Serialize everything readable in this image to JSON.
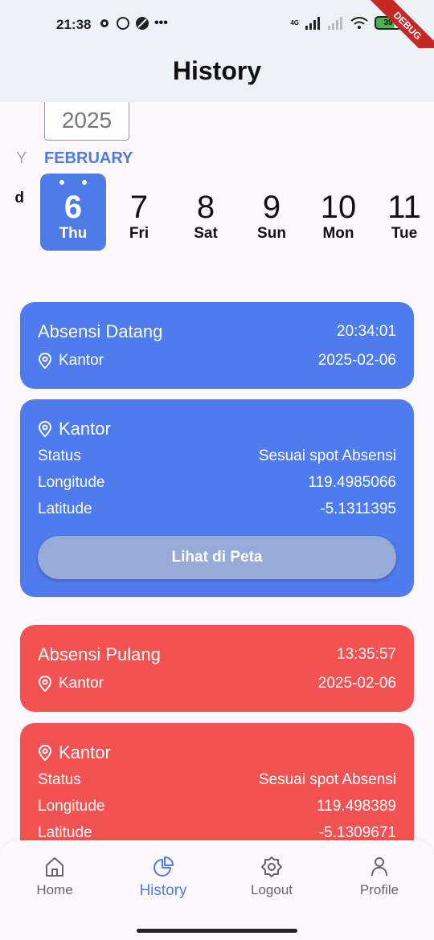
{
  "status_bar": {
    "time": "21:38",
    "battery": "39",
    "debug_label": "DEBUG",
    "network": "4G"
  },
  "app_bar": {
    "title": "History"
  },
  "calendar": {
    "year": "2025",
    "prev_month_fragment": "Y",
    "month": "FEBRUARY",
    "days": [
      {
        "num": "",
        "day": "d"
      },
      {
        "num": "6",
        "day": "Thu",
        "selected": true
      },
      {
        "num": "7",
        "day": "Fri"
      },
      {
        "num": "8",
        "day": "Sat"
      },
      {
        "num": "9",
        "day": "Sun"
      },
      {
        "num": "10",
        "day": "Mon"
      },
      {
        "num": "11",
        "day": "Tue"
      }
    ]
  },
  "records": [
    {
      "summary": {
        "title": "Absensi Datang",
        "time": "20:34:01",
        "location": "Kantor",
        "date": "2025-02-06"
      },
      "detail": {
        "location": "Kantor",
        "status_label": "Status",
        "status": "Sesuai spot Absensi",
        "longitude_label": "Longitude",
        "longitude": "119.4985066",
        "latitude_label": "Latitude",
        "latitude": "-5.1311395",
        "map_button": "Lihat di Peta"
      },
      "color": "#4f7ced"
    },
    {
      "summary": {
        "title": "Absensi Pulang",
        "time": "13:35:57",
        "location": "Kantor",
        "date": "2025-02-06"
      },
      "detail": {
        "location": "Kantor",
        "status_label": "Status",
        "status": "Sesuai spot Absensi",
        "longitude_label": "Longitude",
        "longitude": "119.498389",
        "latitude_label": "Latitude",
        "latitude": "-5.1309671"
      },
      "color": "#f35252"
    }
  ],
  "bottom_nav": {
    "items": [
      {
        "label": "Home",
        "icon": "home-icon"
      },
      {
        "label": "History",
        "icon": "pie-chart-icon",
        "active": true
      },
      {
        "label": "Logout",
        "icon": "gear-icon"
      },
      {
        "label": "Profile",
        "icon": "user-icon"
      }
    ]
  }
}
